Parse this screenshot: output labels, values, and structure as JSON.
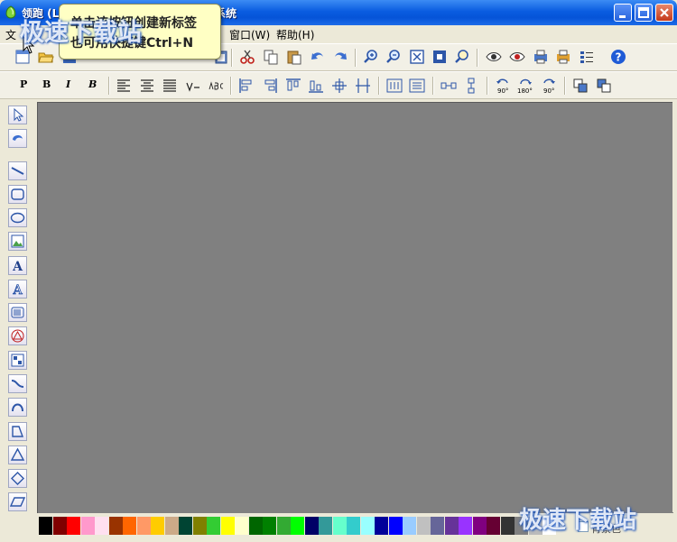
{
  "window": {
    "title_start": "领跑 (L",
    "title_end": "系统"
  },
  "menu": {
    "file": "文",
    "window": "窗口(W)",
    "help": "帮助(H)"
  },
  "tooltip": {
    "line1": "单击该按钮创建新标签",
    "line2": "也可用快捷键Ctrl+N"
  },
  "format_toolbar": {
    "bold_p": "P",
    "bold_b": "B",
    "italic_i": "I",
    "italic_b": "B",
    "rotate_90": "90°",
    "rotate_180": "180°",
    "rotate_90r": "90°"
  },
  "watermark": {
    "top_left": "极速下载站",
    "bottom_right": "极速下载站"
  },
  "palette": {
    "label": "背景色",
    "colors": [
      "#000000",
      "#800000",
      "#FF0000",
      "#FF99CC",
      "#FFE0F0",
      "#993300",
      "#FF6600",
      "#FF9966",
      "#FFCC00",
      "#CCAA88",
      "#004433",
      "#808000",
      "#33CC33",
      "#FFFF00",
      "#FFFFCC",
      "#006600",
      "#008000",
      "#33AA33",
      "#00FF00",
      "#000066",
      "#339999",
      "#66FFCC",
      "#33CCCC",
      "#99FFFF",
      "#000099",
      "#0000FF",
      "#99CCFF",
      "#C0C0C0",
      "#666699",
      "#663399",
      "#9933FF",
      "#800080",
      "#660033",
      "#333333",
      "#808080",
      "#BBBBBB",
      "#FFFFFF"
    ]
  }
}
